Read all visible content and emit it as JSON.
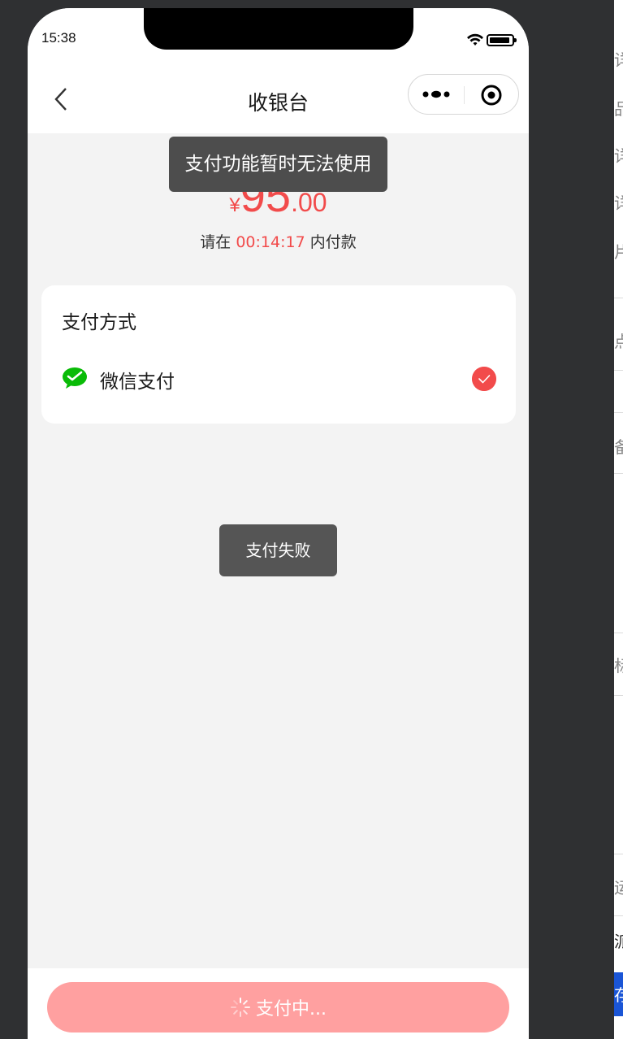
{
  "status_bar": {
    "time": "15:38"
  },
  "nav": {
    "title": "收银台"
  },
  "amount": {
    "currency": "¥",
    "integer": "95",
    "decimal": ".00"
  },
  "countdown": {
    "prefix": "请在 ",
    "time": "00:14:17",
    "suffix": " 内付款"
  },
  "payment": {
    "section_title": "支付方式",
    "methods": [
      {
        "label": "微信支付",
        "selected": true
      }
    ]
  },
  "toasts": {
    "top": "支付功能暂时无法使用",
    "middle": "支付失败"
  },
  "button": {
    "label": "支付中..."
  },
  "side_panel": {
    "glyphs": [
      "详",
      "品",
      "详",
      "详",
      "片",
      "点",
      "备",
      "标",
      "运",
      "派",
      "存"
    ]
  },
  "colors": {
    "accent": "#f24b4b",
    "button_disabled": "#ffa0a0",
    "wechat_green": "#09bb07"
  }
}
